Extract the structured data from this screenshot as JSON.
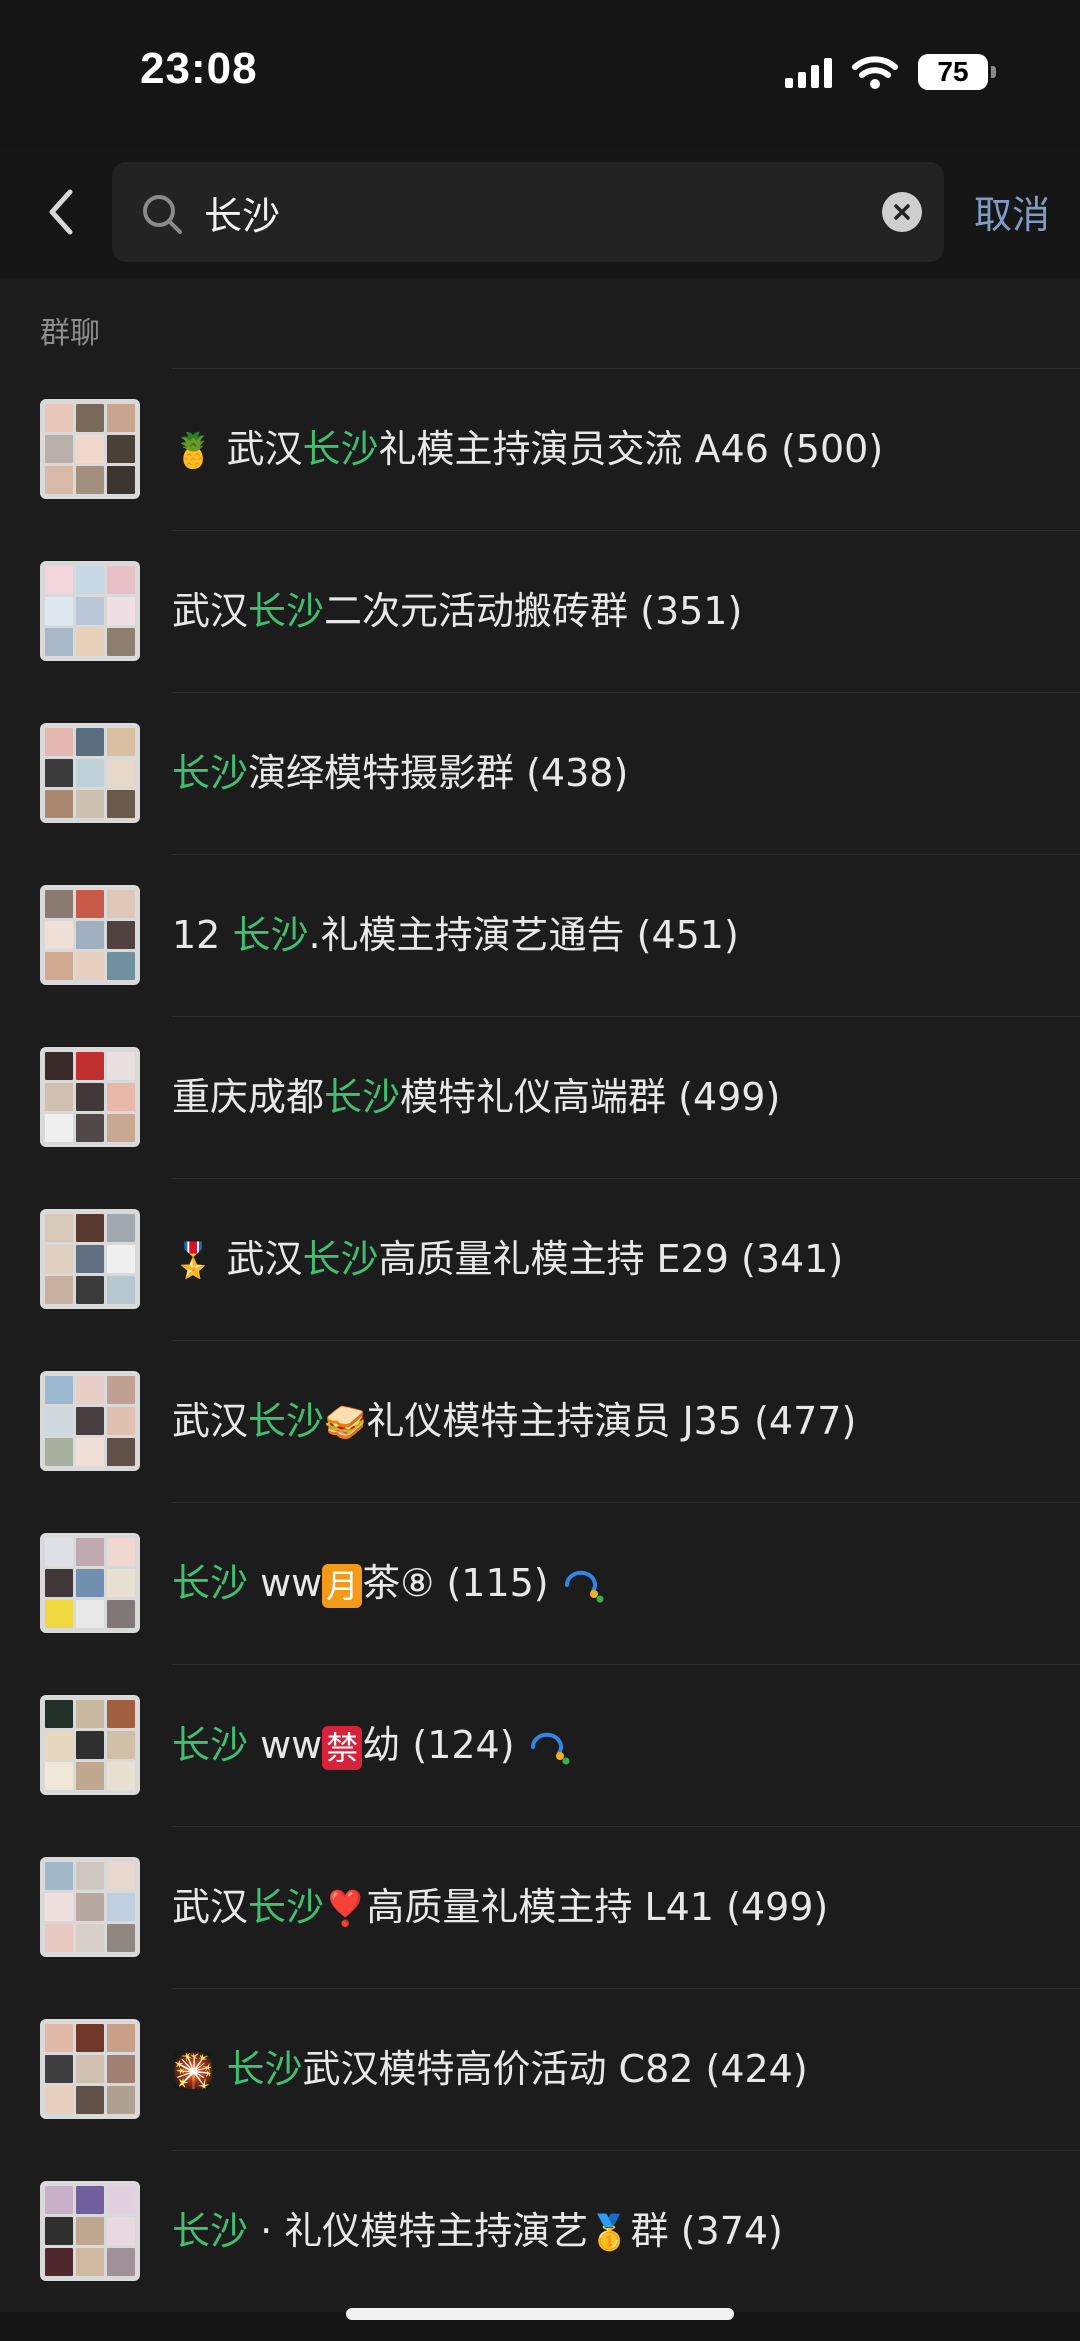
{
  "status": {
    "time": "23:08",
    "battery": "75"
  },
  "search": {
    "query": "长沙",
    "cancel_label": "取消"
  },
  "section": {
    "title": "群聊"
  },
  "colors": {
    "highlight": "#3fbf6f",
    "cancel": "#7f9cc7",
    "background": "#1c1c1c"
  },
  "groups": [
    {
      "prefix_emoji": "🍍",
      "before": "武汉",
      "hl": "长沙",
      "after": "礼模主持演员交流 A46",
      "count": "(500)"
    },
    {
      "prefix_emoji": "",
      "before": "武汉",
      "hl": "长沙",
      "after": "二次元活动搬砖群",
      "count": "(351)"
    },
    {
      "prefix_emoji": "",
      "before": "",
      "hl": "长沙",
      "after": "演绎模特摄影群",
      "count": "(438)"
    },
    {
      "prefix_emoji": "",
      "before": "12 ",
      "hl": "长沙",
      "after": ".礼模主持演艺通告",
      "count": "(451)"
    },
    {
      "prefix_emoji": "",
      "before": "重庆成都",
      "hl": "长沙",
      "after": "模特礼仪高端群",
      "count": "(499)"
    },
    {
      "prefix_emoji": "🎖️",
      "before": "武汉",
      "hl": "长沙",
      "after": "高质量礼模主持 E29",
      "count": "(341)"
    },
    {
      "prefix_emoji": "",
      "before": "武汉",
      "hl": "长沙",
      "mid_emoji": "🥪",
      "after": "礼仪模特主持演员 J35",
      "count": "(477)"
    },
    {
      "prefix_emoji": "",
      "before": "",
      "hl": "长沙",
      "after_a": " ww",
      "badge": "月",
      "badge_color": "orange",
      "after": "茶⑧",
      "count": "(115)",
      "wecom": true
    },
    {
      "prefix_emoji": "",
      "before": "",
      "hl": "长沙",
      "after_a": " ww",
      "badge": "禁",
      "badge_color": "red",
      "after": "幼",
      "count": "(124)",
      "wecom": true
    },
    {
      "prefix_emoji": "",
      "before": "武汉",
      "hl": "长沙",
      "mid_emoji": "❣️",
      "after": "高质量礼模主持 L41",
      "count": "(499)"
    },
    {
      "prefix_emoji": "🎇",
      "before": "",
      "hl": "长沙",
      "after": "武汉模特高价活动 C82",
      "count": "(424)"
    },
    {
      "prefix_emoji": "",
      "before": "",
      "hl": "长沙",
      "after": " · 礼仪模特主持演艺",
      "mid2_emoji": "🥇",
      "after2": "群",
      "count": "(374)"
    }
  ]
}
